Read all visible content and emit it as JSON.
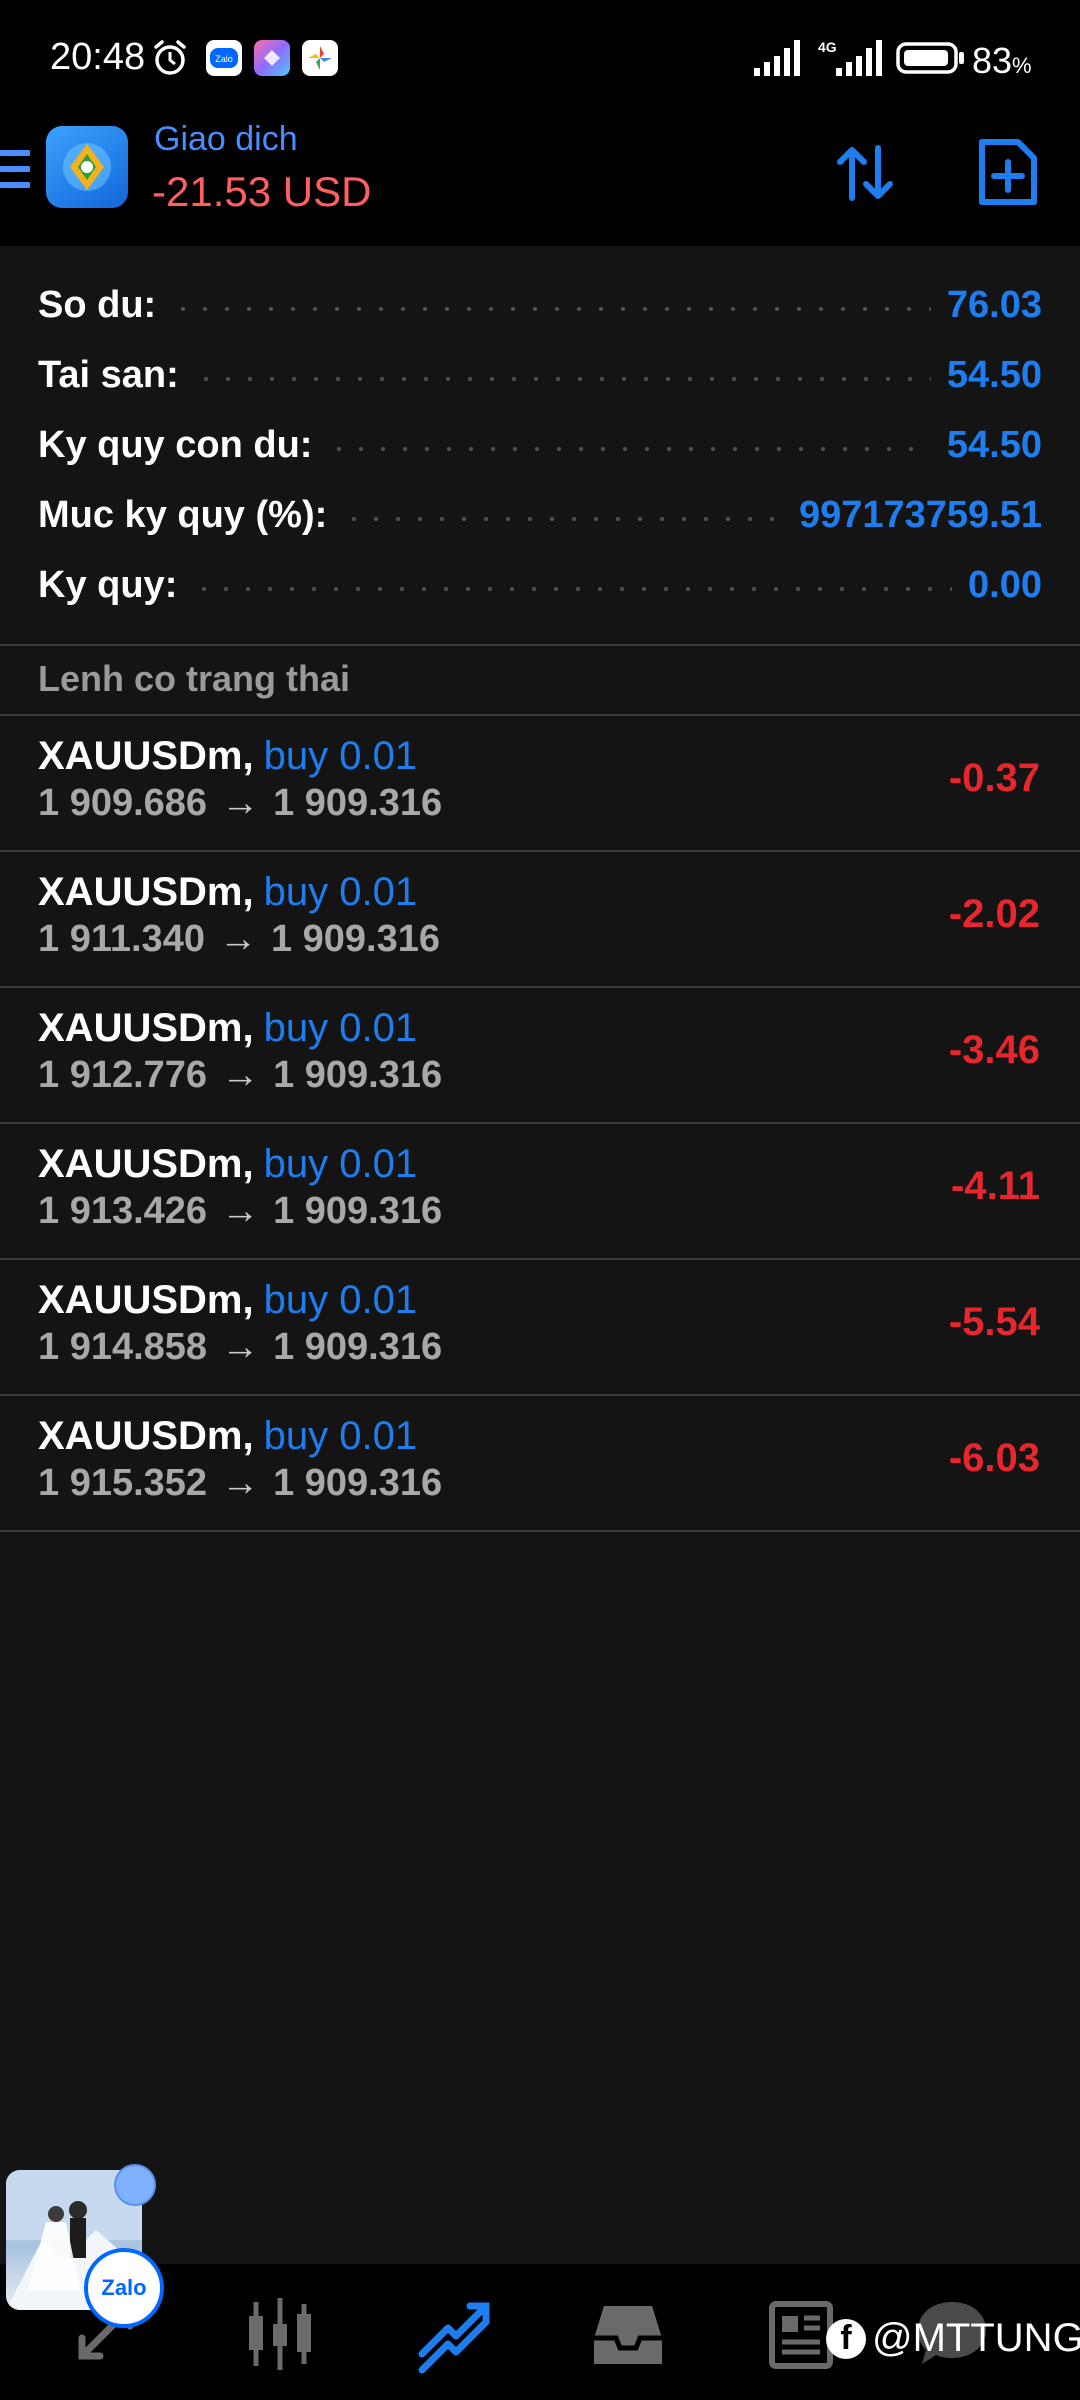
{
  "status_bar": {
    "time": "20:48",
    "battery_pct": "83",
    "battery_unit": "%",
    "network": "4G",
    "icons": [
      "alarm-icon",
      "zalo-app-icon",
      "gallery-app-icon",
      "photos-app-icon",
      "signal-icon",
      "signal-4g-icon",
      "battery-icon"
    ]
  },
  "app_bar": {
    "title": "Giao dich",
    "profit": "-21.53 USD",
    "colors": {
      "title": "#4a8dff",
      "profit": "#ff5f5f"
    },
    "icons": [
      "menu-icon",
      "app-logo-icon",
      "sort-arrows-icon",
      "new-order-icon"
    ]
  },
  "summary": [
    {
      "label": "So du:",
      "value": "76.03"
    },
    {
      "label": "Tai san:",
      "value": "54.50"
    },
    {
      "label": "Ky quy con du:",
      "value": "54.50"
    },
    {
      "label": "Muc ky quy (%):",
      "value": "997173759.51"
    },
    {
      "label": "Ky quy:",
      "value": "0.00"
    }
  ],
  "positions_header": "Lenh co trang thai",
  "positions": [
    {
      "symbol": "XAUUSDm",
      "side": "buy 0.01",
      "open": "1 909.686",
      "current": "1 909.316",
      "profit": "-0.37"
    },
    {
      "symbol": "XAUUSDm",
      "side": "buy 0.01",
      "open": "1 911.340",
      "current": "1 909.316",
      "profit": "-2.02"
    },
    {
      "symbol": "XAUUSDm",
      "side": "buy 0.01",
      "open": "1 912.776",
      "current": "1 909.316",
      "profit": "-3.46"
    },
    {
      "symbol": "XAUUSDm",
      "side": "buy 0.01",
      "open": "1 913.426",
      "current": "1 909.316",
      "profit": "-4.11"
    },
    {
      "symbol": "XAUUSDm",
      "side": "buy 0.01",
      "open": "1 914.858",
      "current": "1 909.316",
      "profit": "-5.54"
    },
    {
      "symbol": "XAUUSDm",
      "side": "buy 0.01",
      "open": "1 915.352",
      "current": "1 909.316",
      "profit": "-6.03"
    }
  ],
  "arrow": "→",
  "bottom_nav": [
    "quotes-icon",
    "chart-icon",
    "trade-icon",
    "history-icon",
    "news-icon",
    "messages-icon"
  ],
  "chat_bubble": {
    "app": "Zalo"
  },
  "watermark": {
    "text": "@MTTUNG",
    "fb": "f"
  },
  "colors": {
    "accent": "#1e7ef0",
    "loss": "#e8262d",
    "background": "#141414",
    "bar": "#000000"
  }
}
